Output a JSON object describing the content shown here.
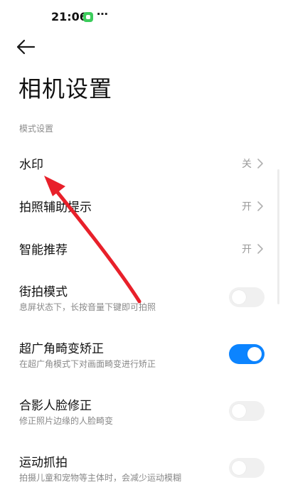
{
  "status_bar": {
    "time": "21:06",
    "more": "⋯",
    "app_icon": "wechat-icon"
  },
  "header": {
    "back_icon": "back-arrow-icon",
    "title": "相机设置"
  },
  "section": {
    "label": "模式设置"
  },
  "rows": [
    {
      "title": "水印",
      "value": "关"
    },
    {
      "title": "拍照辅助提示",
      "value": "开"
    },
    {
      "title": "智能推荐",
      "value": "开"
    },
    {
      "title": "街拍模式",
      "subtitle": "息屏状态下，长按音量下键即可拍照",
      "toggle": false
    },
    {
      "title": "超广角畸变矫正",
      "subtitle": "在超广角模式下对画面畸变进行矫正",
      "toggle": true
    },
    {
      "title": "合影人脸修正",
      "subtitle": "修正照片边缘的人脸畸变",
      "toggle": false
    },
    {
      "title": "运动抓拍",
      "subtitle": "拍摄儿童和宠物等主体时，会减少运动模糊",
      "toggle": false
    }
  ],
  "colors": {
    "accent": "#0c84ff",
    "annotation_arrow": "#e8202a"
  }
}
